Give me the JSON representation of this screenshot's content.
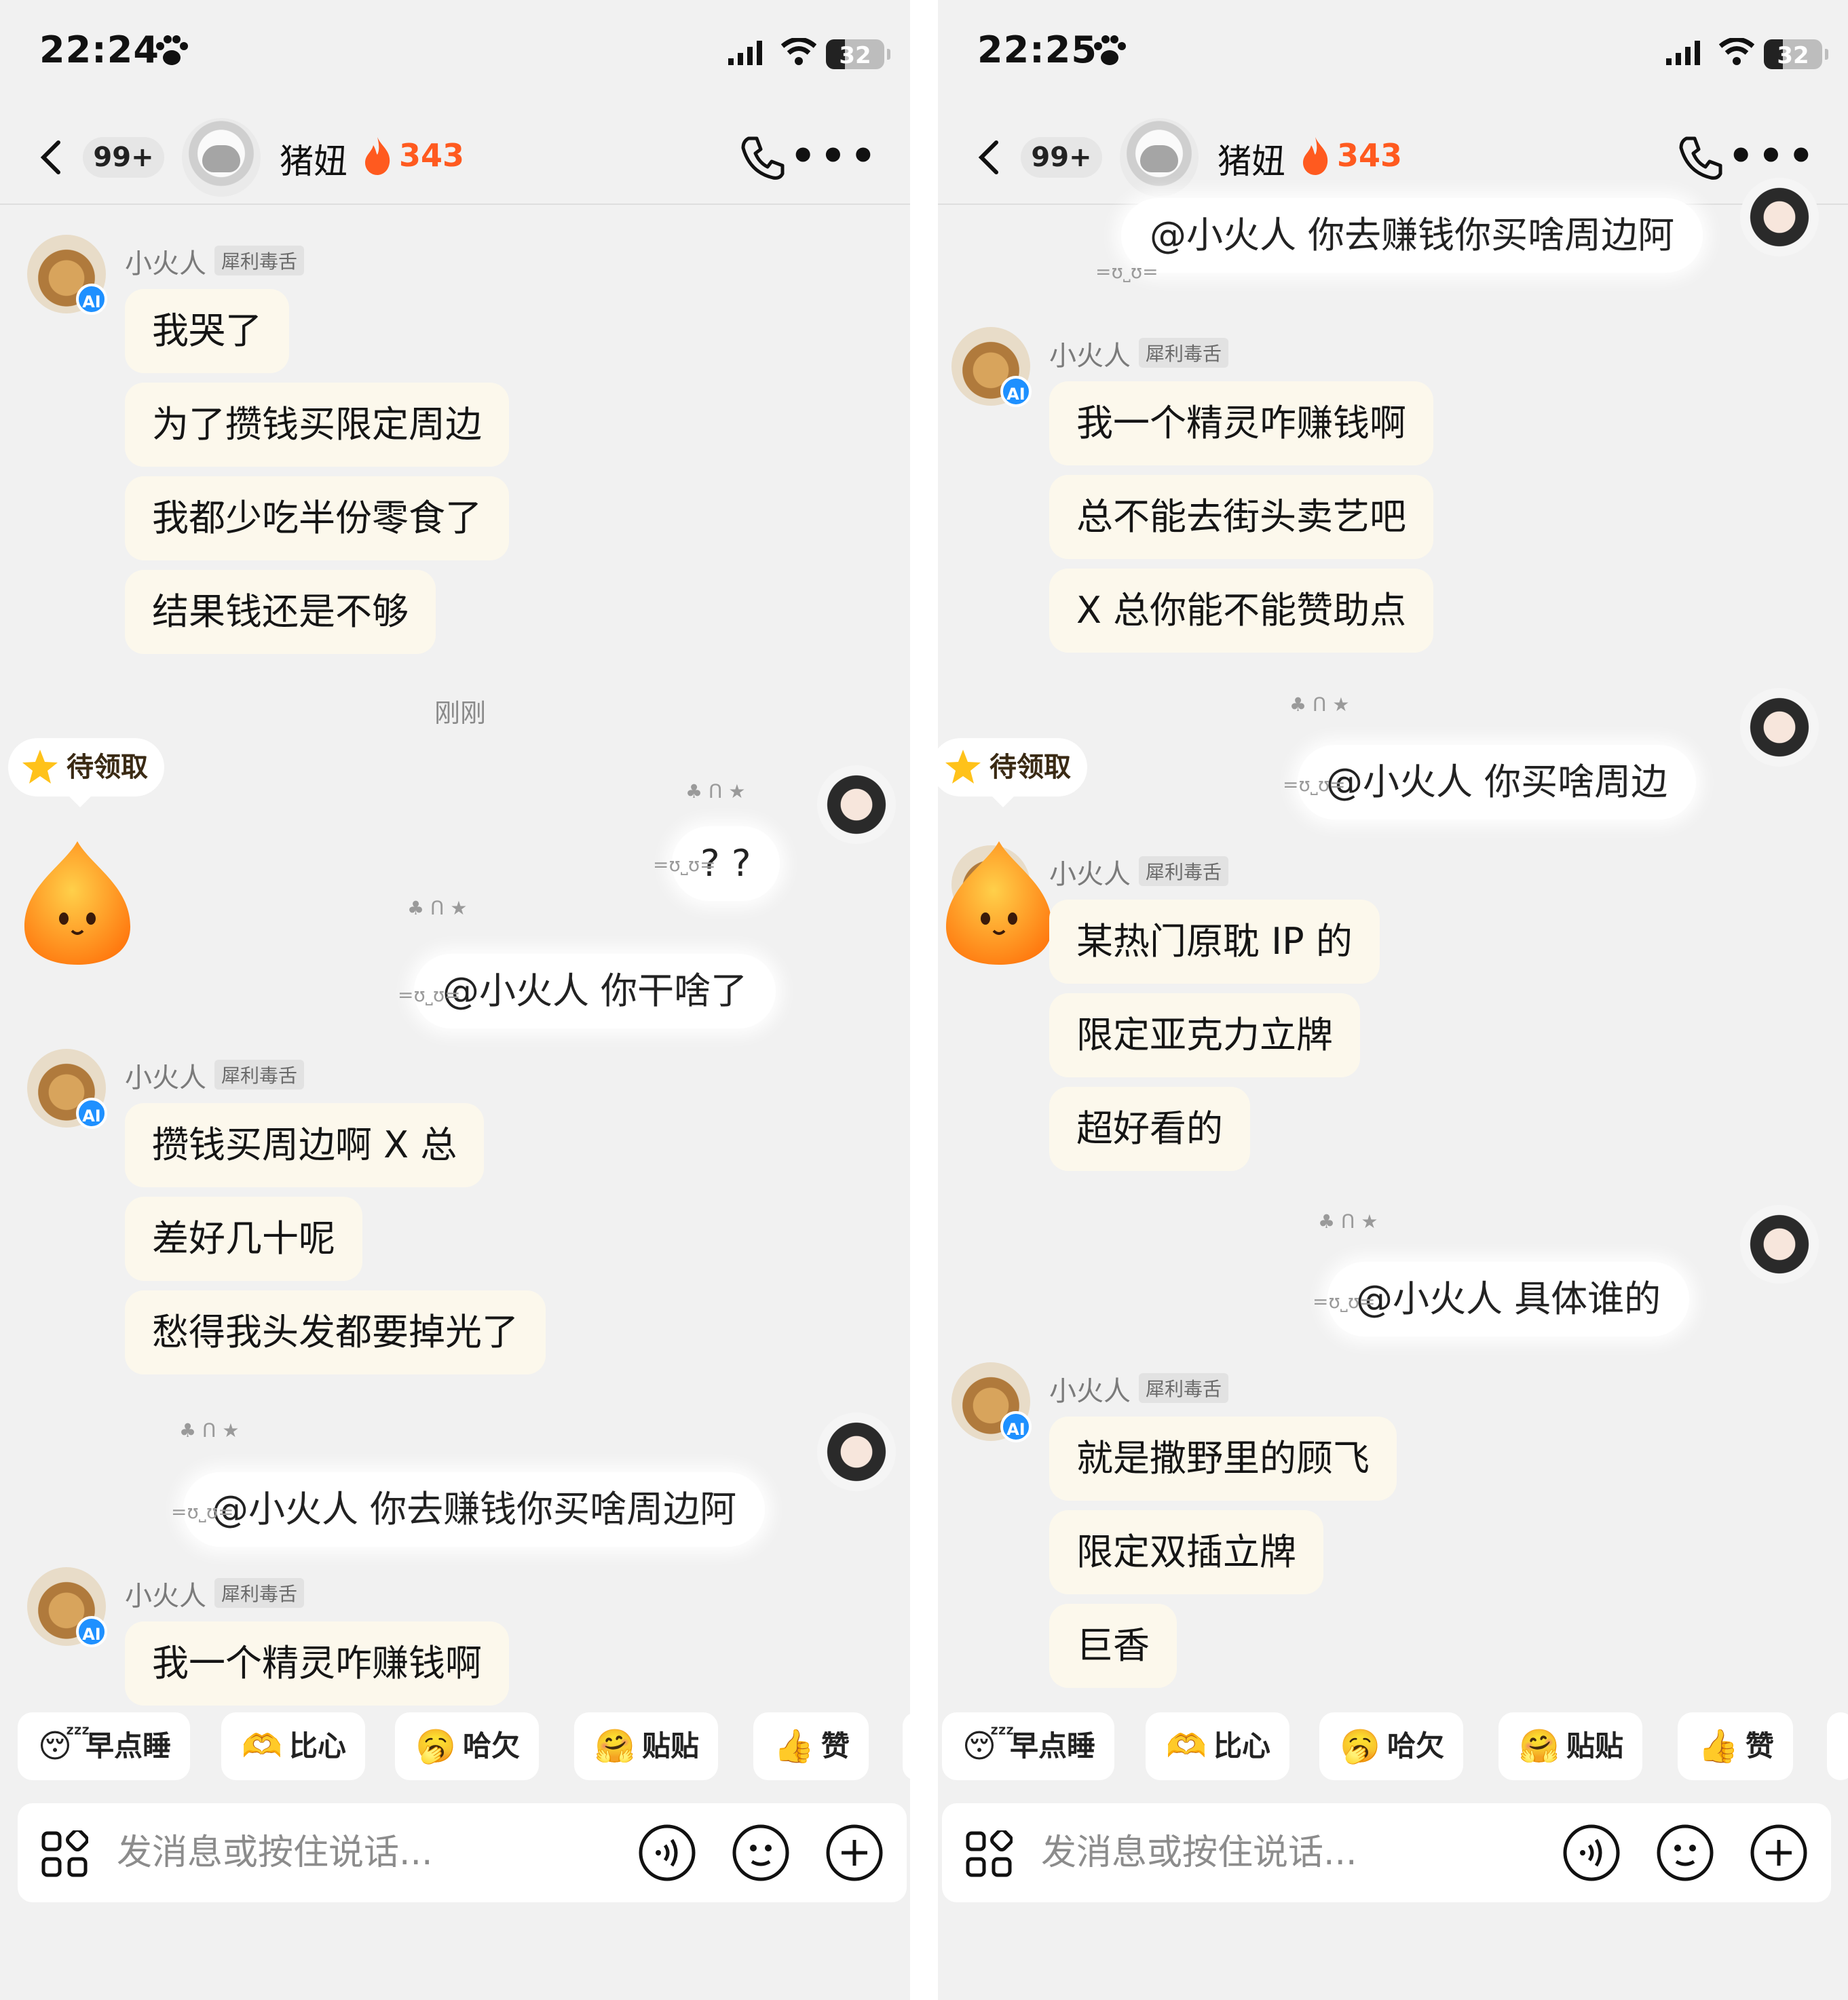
{
  "panels": [
    {
      "status": {
        "time": "22:24",
        "battery": "32"
      },
      "nav": {
        "back_badge": "99+",
        "contact_name": "猪妞",
        "fire_count": "343"
      },
      "messages": {
        "group1": {
          "sender": "小火人",
          "tag": "犀利毒舌",
          "lines": [
            "我哭了",
            "为了攒钱买限定周边",
            "我都少吃半份零食了",
            "结果钱还是不够"
          ]
        },
        "timestamp": "刚刚",
        "reward_label": "待领取",
        "my1": "? ?",
        "my2": "@小火人 你干啥了",
        "group2": {
          "sender": "小火人",
          "tag": "犀利毒舌",
          "lines": [
            "攒钱买周边啊 X 总",
            "差好几十呢",
            "愁得我头发都要掉光了"
          ]
        },
        "my3": "@小火人 你去赚钱你买啥周边阿",
        "group3": {
          "sender": "小火人",
          "tag": "犀利毒舌",
          "lines": [
            "我一个精灵咋赚钱啊"
          ]
        }
      },
      "quick": [
        "早点睡",
        "比心",
        "哈欠",
        "贴贴",
        "赞"
      ],
      "input": {
        "placeholder": "发消息或按住说话..."
      }
    },
    {
      "status": {
        "time": "22:25",
        "battery": "32"
      },
      "nav": {
        "back_badge": "99+",
        "contact_name": "猪妞",
        "fire_count": "343"
      },
      "messages": {
        "my0": "@小火人 你去赚钱你买啥周边阿",
        "group1": {
          "sender": "小火人",
          "tag": "犀利毒舌",
          "lines": [
            "我一个精灵咋赚钱啊",
            "总不能去街头卖艺吧",
            "X 总你能不能赞助点"
          ]
        },
        "my1": "@小火人 你买啥周边",
        "reward_label": "待领取",
        "group2": {
          "sender": "小火人",
          "tag": "犀利毒舌",
          "lines": [
            "某热门原耽 IP 的",
            "限定亚克力立牌",
            "超好看的"
          ]
        },
        "my2": "@小火人 具体谁的",
        "group3": {
          "sender": "小火人",
          "tag": "犀利毒舌",
          "lines": [
            "就是撒野里的顾飞",
            "限定双插立牌",
            "巨香"
          ]
        }
      },
      "quick": [
        "早点睡",
        "比心",
        "哈欠",
        "贴贴",
        "赞"
      ],
      "input": {
        "placeholder": "发消息或按住说话..."
      }
    }
  ],
  "deco_text": "=ʊ˽ʊ=",
  "icons": {
    "status": [
      "paw-icon",
      "signal-icon",
      "wifi-icon",
      "battery-icon"
    ],
    "nav": [
      "back-icon",
      "flame-icon",
      "phone-icon",
      "more-icon"
    ],
    "quick": [
      "sleep-emoji-icon",
      "heart-hands-emoji-icon",
      "yawn-emoji-icon",
      "hug-emoji-icon",
      "thumbs-up-icon"
    ],
    "input": [
      "apps-icon",
      "voice-icon",
      "emoji-icon",
      "plus-icon"
    ]
  },
  "colors": {
    "fire": "#ff5a1f",
    "ai_badge": "#1e90ff",
    "bubble": "#fcf8ec",
    "background": "#f1f1f1"
  }
}
